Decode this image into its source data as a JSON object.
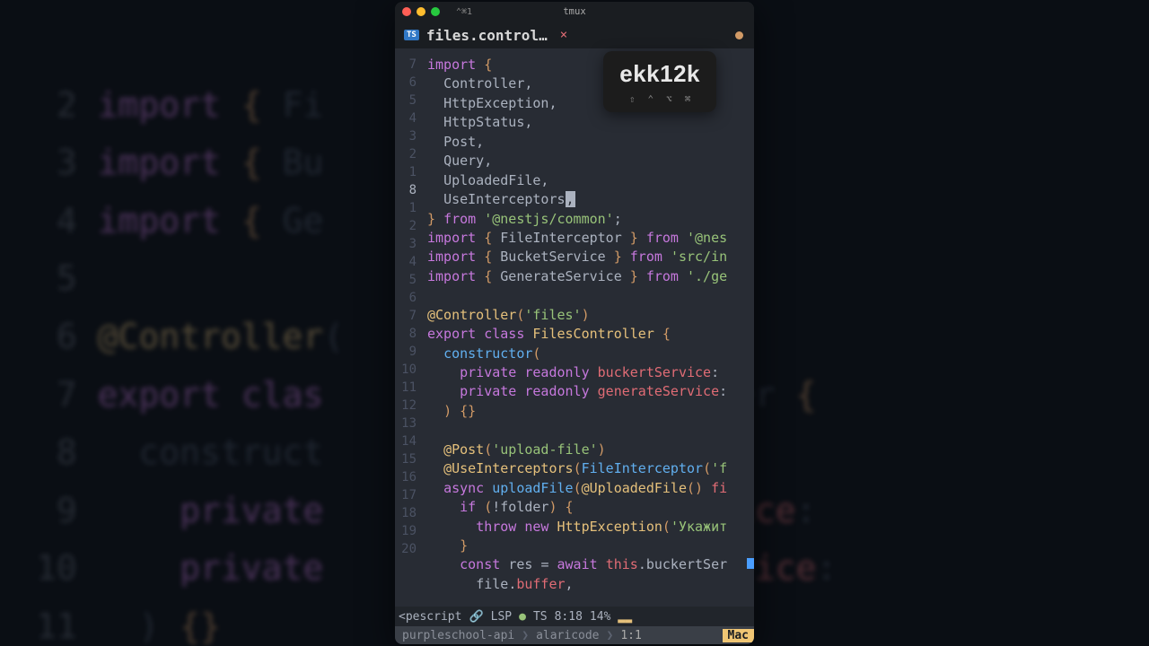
{
  "titlebar": {
    "shortcut": "⌃⌘1",
    "title": "tmux"
  },
  "tab": {
    "filetype": "TS",
    "filename": "files.control…",
    "close": "×"
  },
  "gutter": [
    "7",
    "6",
    "5",
    "4",
    "3",
    "2",
    "1",
    "8",
    "1",
    "2",
    "3",
    "4",
    "5",
    "6",
    "7",
    "8",
    "9",
    "10",
    "11",
    "12",
    "13",
    "14",
    "15",
    "16",
    "17",
    "18",
    "19",
    "20"
  ],
  "code": {
    "l1": {
      "kw": "import",
      "b1": "{"
    },
    "l2": "Controller,",
    "l3": "HttpException,",
    "l4": "HttpStatus,",
    "l5": "Post,",
    "l6": "Query,",
    "l7": "UploadedFile,",
    "l8a": "UseInterceptors",
    "l8b": ",",
    "l9": {
      "b": "}",
      "kw": "from",
      "s": "'@nestjs/common'",
      "p": ";"
    },
    "l10": {
      "kw": "import",
      "b1": "{",
      "id": "FileInterceptor",
      "b2": "}",
      "kw2": "from",
      "s": "'@nes"
    },
    "l11": {
      "kw": "import",
      "b1": "{",
      "id": "BucketService",
      "b2": "}",
      "kw2": "from",
      "s": "'src/in"
    },
    "l12": {
      "kw": "import",
      "b1": "{",
      "id": "GenerateService",
      "b2": "}",
      "kw2": "from",
      "s": "'./ge"
    },
    "l14": {
      "dec": "@Controller",
      "p1": "(",
      "s": "'files'",
      "p2": ")"
    },
    "l15": {
      "kw1": "export",
      "kw2": "class",
      "id": "FilesController",
      "b": "{"
    },
    "l16": {
      "id": "constructor",
      "p": "("
    },
    "l17": {
      "kw1": "private",
      "kw2": "readonly",
      "id": "buckertService",
      "p": ":"
    },
    "l18": {
      "kw1": "private",
      "kw2": "readonly",
      "id": "generateService",
      "p": ":"
    },
    "l19": {
      "p1": ")",
      "b": "{}"
    },
    "l21": {
      "dec": "@Post",
      "p1": "(",
      "s": "'upload-file'",
      "p2": ")"
    },
    "l22": {
      "dec": "@UseInterceptors",
      "p1": "(",
      "fn": "FileInterceptor",
      "p2": "(",
      "s": "'f"
    },
    "l23": {
      "kw": "async",
      "fn": "uploadFile",
      "p1": "(",
      "dec": "@UploadedFile",
      "p2": "()",
      "id": "fi"
    },
    "l24": {
      "kw": "if",
      "p1": "(",
      "op": "!",
      "id": "folder",
      "p2": ")",
      "b": "{"
    },
    "l25": {
      "kw1": "throw",
      "kw2": "new",
      "cls": "HttpException",
      "p": "(",
      "s": "'Укажит"
    },
    "l26": {
      "b": "}"
    },
    "l27": {
      "kw": "const",
      "id": "res",
      "op": "=",
      "kw2": "await",
      "this": "this",
      "p": ".",
      "id2": "buckertSer"
    },
    "l28": {
      "id": "file",
      "p": ".",
      "id2": "buffer",
      "p2": ","
    }
  },
  "statusbar": {
    "mode": "<pescript",
    "link": "🔗",
    "lsp": "LSP",
    "ts": "TS",
    "pos": "8:18",
    "pct": "14%",
    "block": "▂▂"
  },
  "bottombar": {
    "seg1": "purpleschool-api",
    "seg2": "alaricode",
    "pos": "1:1",
    "os": "Mac"
  },
  "keycast": {
    "text": "ekk12k",
    "mods": [
      "⇧",
      "⌃",
      "⌥",
      "⌘"
    ]
  },
  "bg_lines": [
    {
      "n": "2",
      "t": "import { Fi        } from '@nes"
    },
    {
      "n": "3",
      "t": "import { Bu        from 'src/in"
    },
    {
      "n": "4",
      "t": "import { Ge        } from './ge"
    },
    {
      "n": "5",
      "t": ""
    },
    {
      "n": "6",
      "t": "@Controller("
    },
    {
      "n": "7",
      "t": "export clas                  ller {"
    },
    {
      "n": "8",
      "t": "  construct"
    },
    {
      "n": "9",
      "t": "    private            kertService:"
    },
    {
      "n": "10",
      "t": "    private            erateService:"
    },
    {
      "n": "11",
      "t": "  ) {}"
    }
  ]
}
